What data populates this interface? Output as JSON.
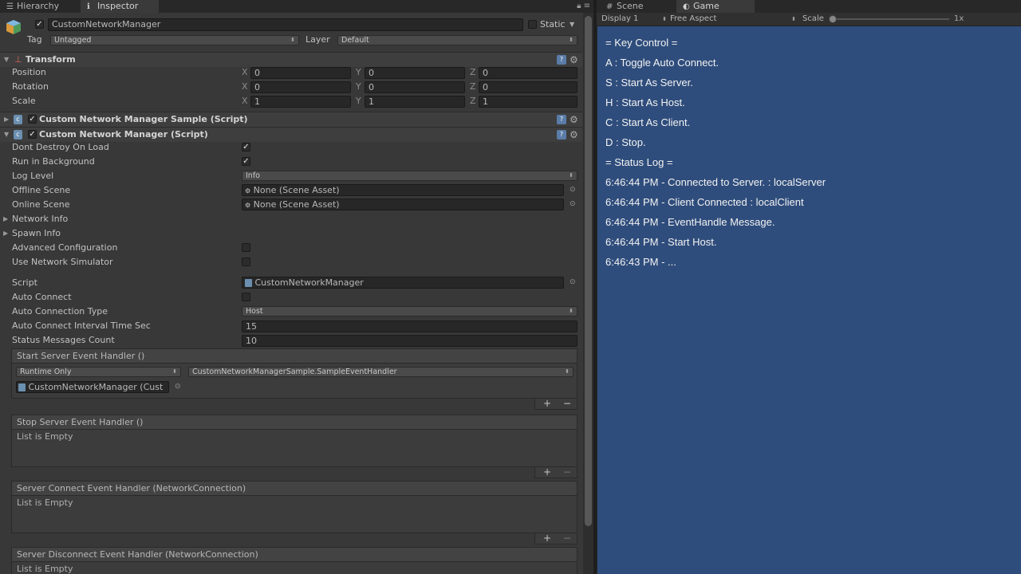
{
  "tabs": {
    "hierarchy": "Hierarchy",
    "inspector": "Inspector",
    "scene": "Scene",
    "game": "Game"
  },
  "object": {
    "name": "CustomNetworkManager",
    "static_label": "Static",
    "tag_label": "Tag",
    "tag_value": "Untagged",
    "layer_label": "Layer",
    "layer_value": "Default"
  },
  "transform": {
    "title": "Transform",
    "position_label": "Position",
    "rotation_label": "Rotation",
    "scale_label": "Scale",
    "position": [
      "0",
      "0",
      "0"
    ],
    "rotation": [
      "0",
      "0",
      "0"
    ],
    "scale": [
      "1",
      "1",
      "1"
    ]
  },
  "components": {
    "sample_title": "Custom Network Manager Sample (Script)",
    "manager_title": "Custom Network Manager (Script)"
  },
  "fields": {
    "dont_destroy": "Dont Destroy On Load",
    "run_background": "Run in Background",
    "log_level": "Log Level",
    "log_level_value": "Info",
    "offline_scene": "Offline Scene",
    "offline_scene_value": "None (Scene Asset)",
    "online_scene": "Online Scene",
    "online_scene_value": "None (Scene Asset)",
    "network_info": "Network Info",
    "spawn_info": "Spawn Info",
    "advanced_config": "Advanced Configuration",
    "use_sim": "Use Network Simulator",
    "script": "Script",
    "script_value": "CustomNetworkManager",
    "auto_connect": "Auto Connect",
    "auto_conn_type": "Auto Connection Type",
    "auto_conn_type_value": "Host",
    "interval": "Auto Connect Interval Time Sec",
    "interval_value": "15",
    "status_count": "Status Messages Count",
    "status_count_value": "10"
  },
  "events": {
    "start_server": "Start Server Event Handler ()",
    "runtime": "Runtime Only",
    "handler": "CustomNetworkManagerSample.SampleEventHandler",
    "target": "CustomNetworkManager (Cust",
    "stop_server": "Stop Server Event Handler ()",
    "server_connect": "Server Connect Event Handler (NetworkConnection)",
    "server_disconnect": "Server Disconnect Event Handler (NetworkConnection)",
    "list_empty": "List is Empty"
  },
  "game_toolbar": {
    "display": "Display 1",
    "aspect": "Free Aspect",
    "scale_label": "Scale",
    "scale_value": "1x"
  },
  "game_log": [
    "= Key Control =",
    "A : Toggle Auto Connect.",
    "S : Start As Server.",
    "H : Start As Host.",
    "C : Start As Client.",
    "D : Stop.",
    "= Status Log =",
    "6:46:44 PM - Connected to Server. : localServer",
    "6:46:44 PM - Client Connected : localClient",
    "6:46:44 PM - EventHandle Message.",
    "6:46:44 PM - Start Host.",
    "6:46:43 PM - ..."
  ],
  "colors": {
    "game_bg": "#2f4d7c",
    "panel_bg": "#383838"
  }
}
